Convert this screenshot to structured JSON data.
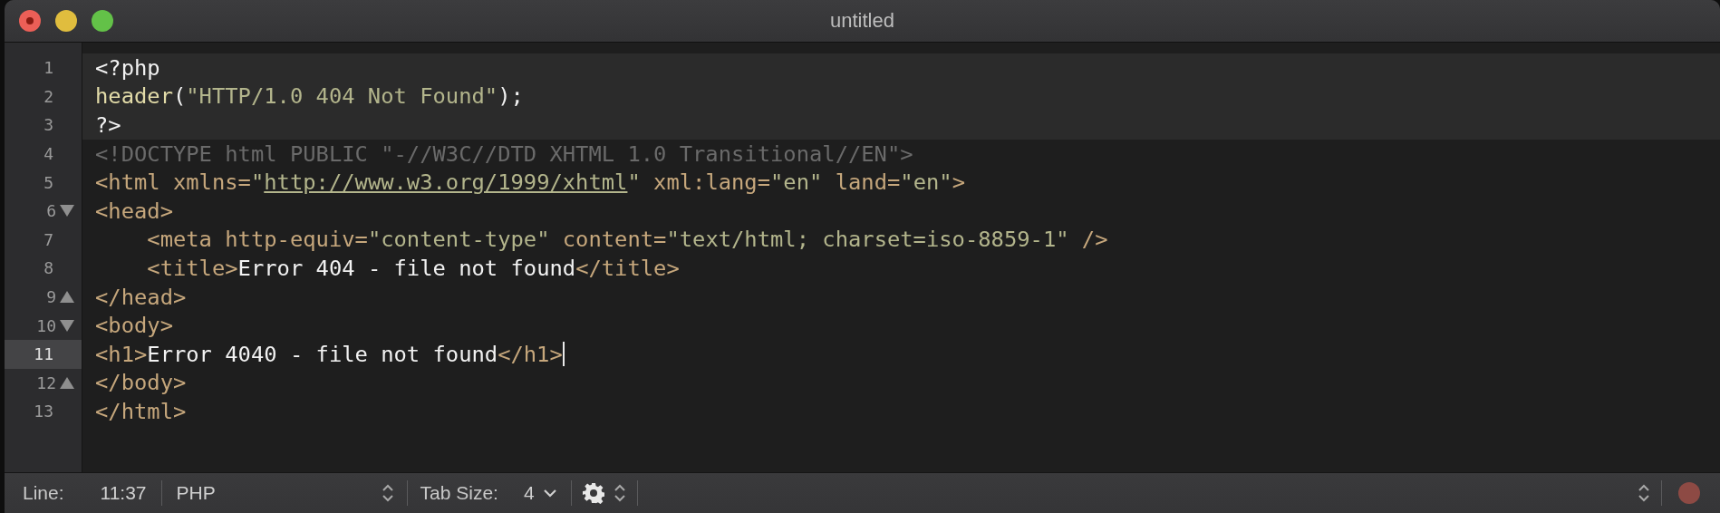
{
  "window": {
    "title": "untitled",
    "buttons": [
      {
        "kind": "close"
      },
      {
        "kind": "minimize"
      },
      {
        "kind": "zoom"
      }
    ]
  },
  "editor": {
    "lines": [
      {
        "number": "1",
        "selected": false,
        "embedded": true,
        "fold_start": false,
        "fold_end": false,
        "tokens": [
          {
            "text": "<?php",
            "kind": "plain"
          }
        ]
      },
      {
        "number": "2",
        "selected": false,
        "embedded": true,
        "fold_start": false,
        "fold_end": false,
        "tokens": [
          {
            "text": "header",
            "kind": "func"
          },
          {
            "text": "(",
            "kind": "plain"
          },
          {
            "text": "\"HTTP/1.0 404 Not Found\"",
            "kind": "string"
          },
          {
            "text": ");",
            "kind": "plain"
          }
        ]
      },
      {
        "number": "3",
        "selected": false,
        "embedded": true,
        "fold_start": false,
        "fold_end": false,
        "tokens": [
          {
            "text": "?>",
            "kind": "plain"
          }
        ]
      },
      {
        "number": "4",
        "selected": false,
        "embedded": false,
        "fold_start": false,
        "fold_end": false,
        "tokens": [
          {
            "text": "<!DOCTYPE html PUBLIC \"-//W3C//DTD XHTML 1.0 Transitional//EN\">",
            "kind": "comment"
          }
        ]
      },
      {
        "number": "5",
        "selected": false,
        "embedded": false,
        "fold_start": false,
        "fold_end": false,
        "tokens": [
          {
            "text": "<html xmlns=",
            "kind": "tag"
          },
          {
            "text": "\"",
            "kind": "string"
          },
          {
            "text": "http://www.w3.org/1999/xhtml",
            "kind": "link"
          },
          {
            "text": "\"",
            "kind": "string"
          },
          {
            "text": " xml:lang=",
            "kind": "tag"
          },
          {
            "text": "\"en\"",
            "kind": "string"
          },
          {
            "text": " land=",
            "kind": "tag"
          },
          {
            "text": "\"en\"",
            "kind": "string"
          },
          {
            "text": ">",
            "kind": "tag"
          }
        ]
      },
      {
        "number": "6",
        "selected": false,
        "embedded": false,
        "fold_start": true,
        "fold_end": false,
        "tokens": [
          {
            "text": "<head>",
            "kind": "tag"
          }
        ]
      },
      {
        "number": "7",
        "selected": false,
        "embedded": false,
        "fold_start": false,
        "fold_end": false,
        "tokens": [
          {
            "text": "    <meta http-equiv=",
            "kind": "tag"
          },
          {
            "text": "\"content-type\"",
            "kind": "string"
          },
          {
            "text": " content=",
            "kind": "tag"
          },
          {
            "text": "\"text/html; charset=iso-8859-1\"",
            "kind": "string"
          },
          {
            "text": " />",
            "kind": "tag"
          }
        ]
      },
      {
        "number": "8",
        "selected": false,
        "embedded": false,
        "fold_start": false,
        "fold_end": false,
        "tokens": [
          {
            "text": "    <title>",
            "kind": "tag"
          },
          {
            "text": "Error 404 - file not found",
            "kind": "plain"
          },
          {
            "text": "</title>",
            "kind": "tag"
          }
        ]
      },
      {
        "number": "9",
        "selected": false,
        "embedded": false,
        "fold_start": false,
        "fold_end": true,
        "tokens": [
          {
            "text": "</head>",
            "kind": "tag"
          }
        ]
      },
      {
        "number": "10",
        "selected": false,
        "embedded": false,
        "fold_start": true,
        "fold_end": false,
        "tokens": [
          {
            "text": "<body>",
            "kind": "tag"
          }
        ]
      },
      {
        "number": "11",
        "selected": true,
        "embedded": false,
        "fold_start": false,
        "fold_end": false,
        "tokens": [
          {
            "text": "<h1>",
            "kind": "tag"
          },
          {
            "text": "Error 4040 - file not found",
            "kind": "plain"
          },
          {
            "text": "</h1>",
            "kind": "tag"
          }
        ]
      },
      {
        "number": "12",
        "selected": false,
        "embedded": false,
        "fold_start": false,
        "fold_end": true,
        "tokens": [
          {
            "text": "</body>",
            "kind": "tag"
          }
        ]
      },
      {
        "number": "13",
        "selected": false,
        "embedded": false,
        "fold_start": false,
        "fold_end": false,
        "tokens": [
          {
            "text": "</html>",
            "kind": "tag"
          }
        ]
      }
    ]
  },
  "status_bar": {
    "line_label": "Line:",
    "position": "11:37",
    "syntax": "PHP",
    "tab_size_label": "Tab Size:",
    "tab_size": "4",
    "recording": true
  }
}
